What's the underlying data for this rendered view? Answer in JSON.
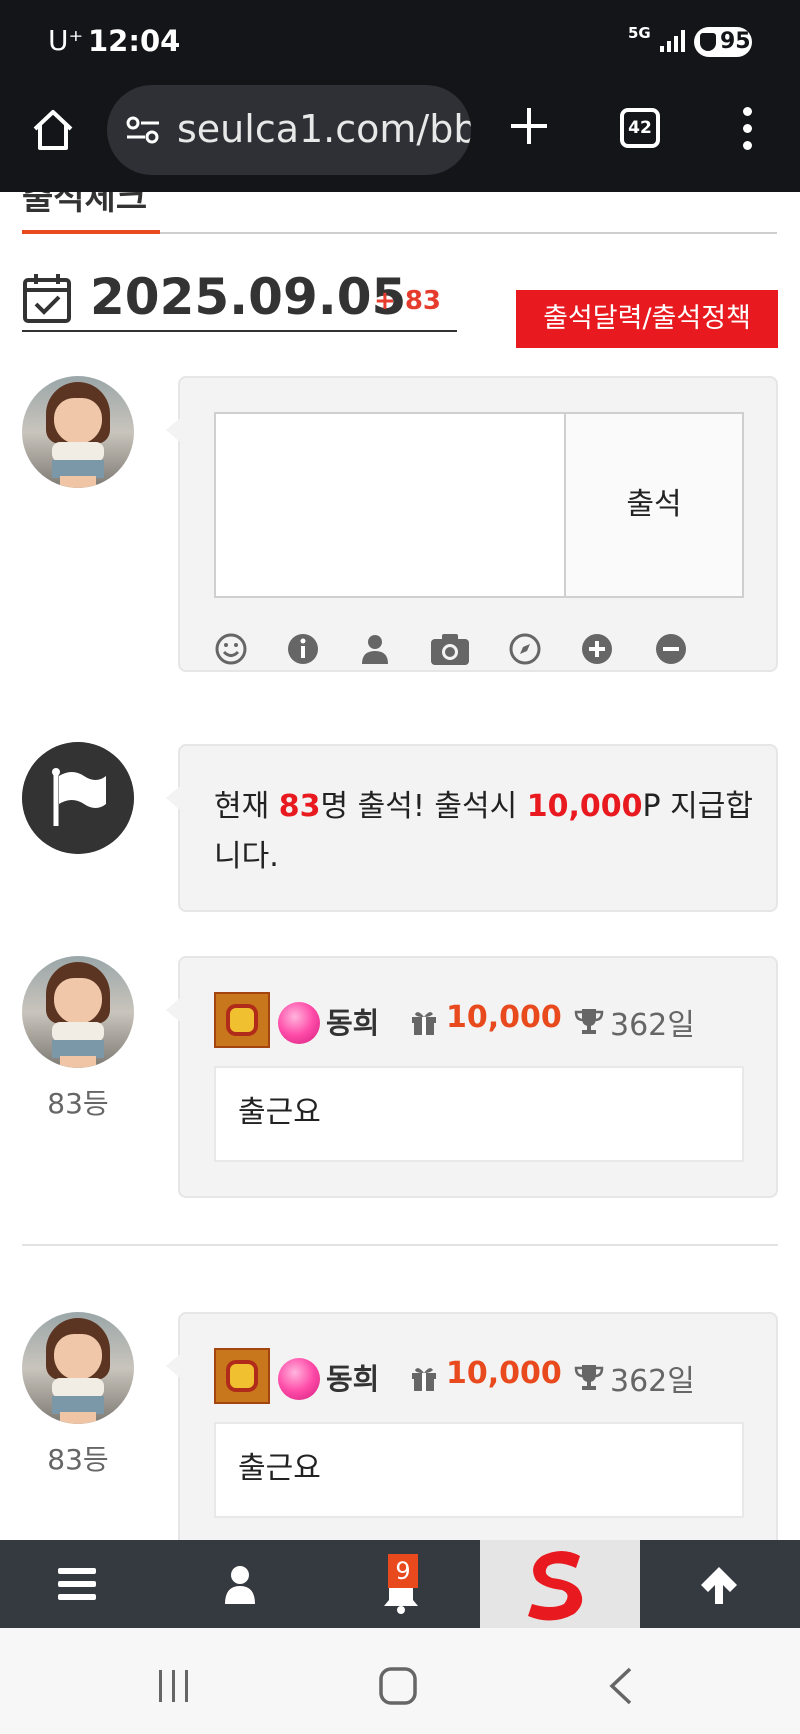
{
  "status_bar": {
    "carrier": "U⁺",
    "time": "12:04",
    "network": "5G",
    "battery": "95"
  },
  "browser": {
    "url": "seulca1.com/bb",
    "tab_count": "42"
  },
  "page": {
    "tab_title": "출석체크",
    "date": "2025.09.05",
    "count_delta": "+ 83",
    "policy_button": "출석달력/출석정책",
    "form": {
      "submit_label": "출석",
      "textarea_value": ""
    },
    "notice": {
      "prefix": "현재 ",
      "count": "83",
      "middle": "명 출석! 출석시 ",
      "points": "10,000",
      "suffix": "P 지급합니다."
    },
    "entries": [
      {
        "rank": "83등",
        "username": "동희",
        "points": "10,000",
        "days": "362일",
        "message": "출근요"
      },
      {
        "rank": "83등",
        "username": "동희",
        "points": "10,000",
        "days": "362일",
        "message": "출근요"
      }
    ]
  },
  "bottom_nav": {
    "notification_count": "9"
  },
  "colors": {
    "accent": "#e84a1d",
    "red": "#e8191f",
    "nav_bg": "#343a40"
  }
}
